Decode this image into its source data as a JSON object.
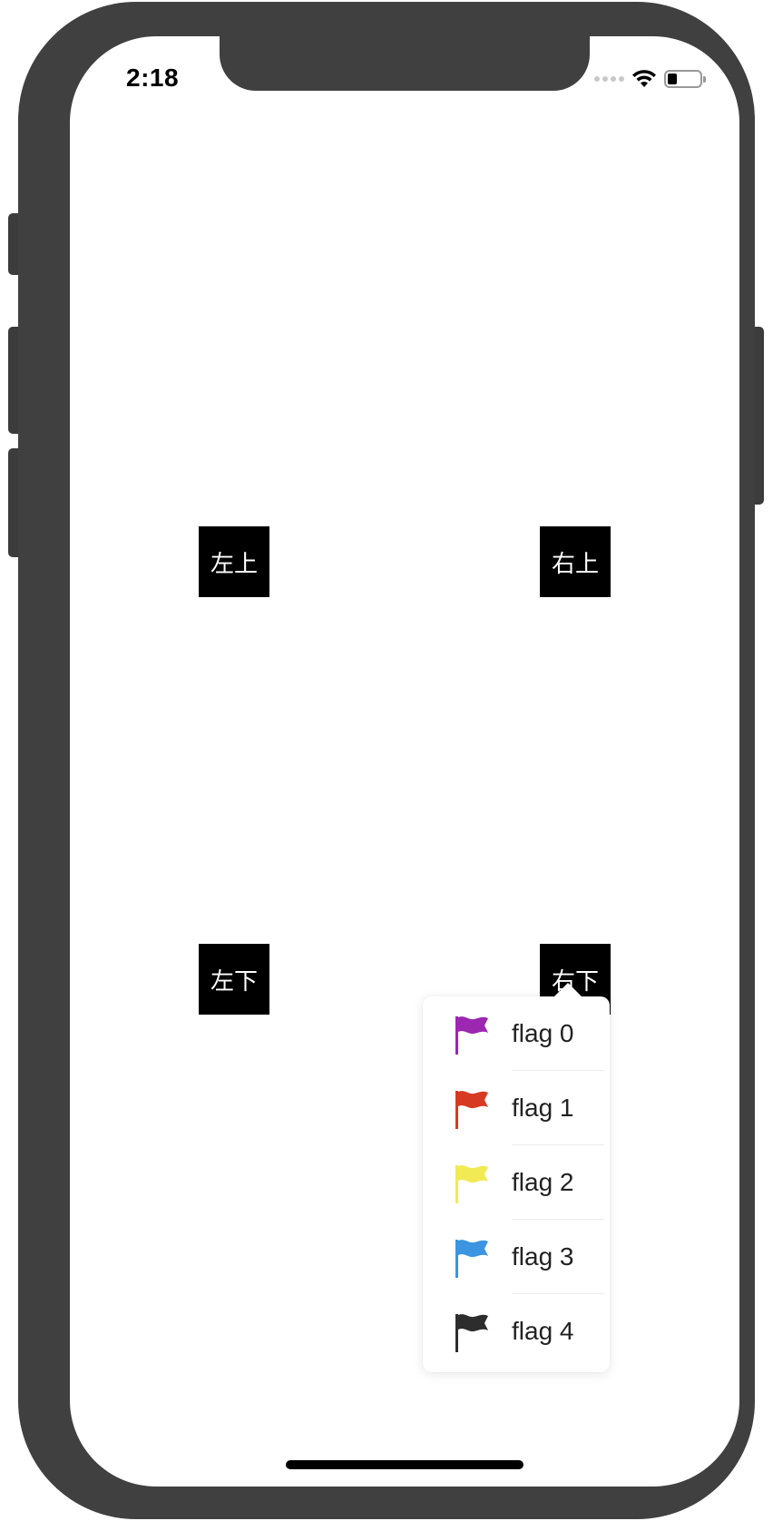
{
  "status_bar": {
    "time": "2:18",
    "wifi_icon": "wifi-icon",
    "battery_icon": "battery-icon",
    "battery_level": 0.3
  },
  "buttons": {
    "top_left": "左上",
    "top_right": "右上",
    "bottom_left": "左下",
    "bottom_right": "右下"
  },
  "popover_menu": {
    "items": [
      {
        "label": "flag 0",
        "icon": "flag-icon",
        "color": "#9c27b0"
      },
      {
        "label": "flag 1",
        "icon": "flag-icon",
        "color": "#d73a22"
      },
      {
        "label": "flag 2",
        "icon": "flag-icon",
        "color": "#f2ea55"
      },
      {
        "label": "flag 3",
        "icon": "flag-icon",
        "color": "#3b95e0"
      },
      {
        "label": "flag 4",
        "icon": "flag-icon",
        "color": "#2d2d2d"
      }
    ]
  },
  "colors": {
    "device_frame": "#404040",
    "button_background": "#000000",
    "button_text": "#ffffff",
    "screen_background": "#ffffff"
  }
}
